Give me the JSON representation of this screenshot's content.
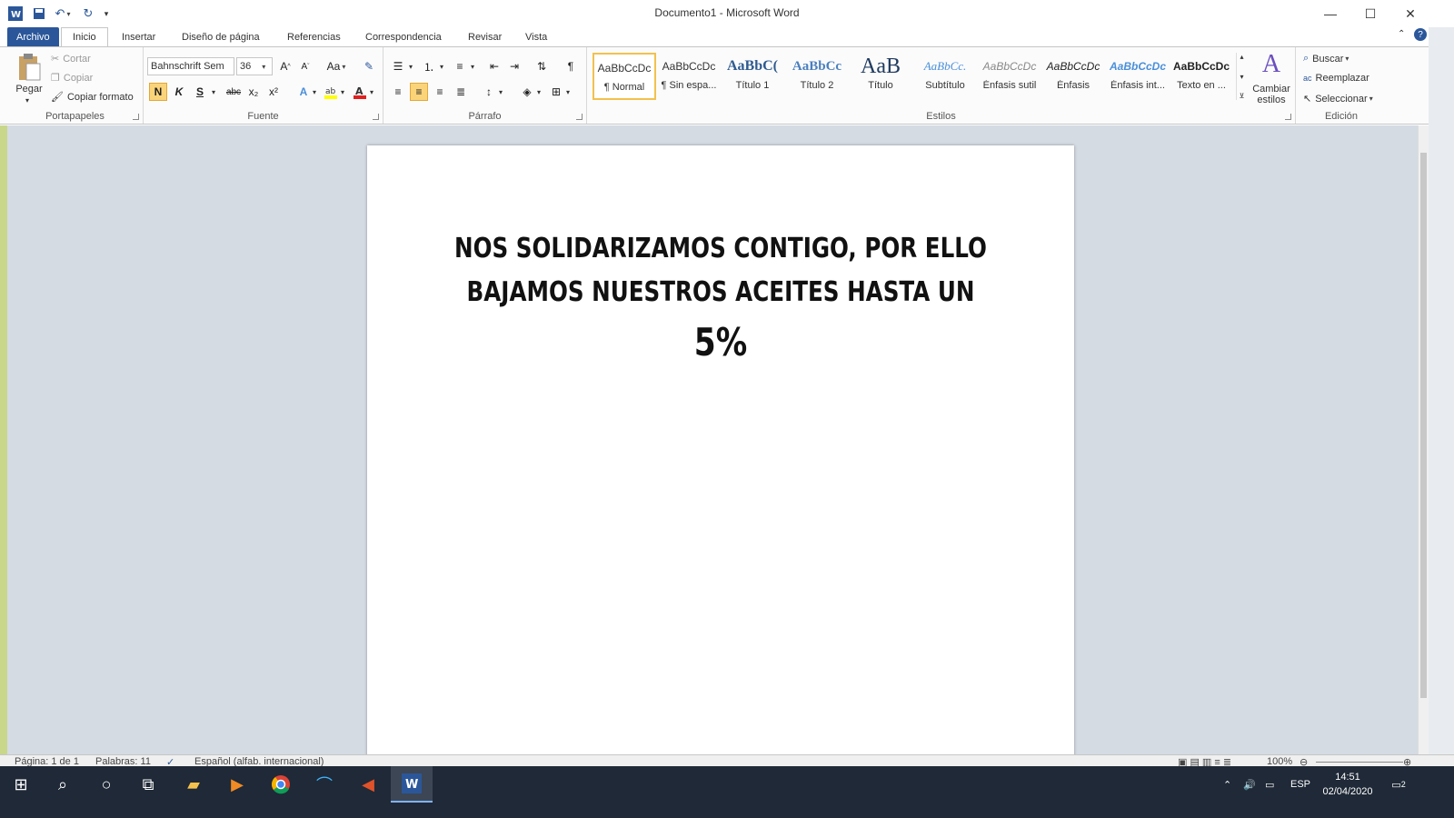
{
  "window": {
    "title": "Documento1  -  Microsoft Word",
    "minimize": "—",
    "maximize": "☐",
    "close": "✕"
  },
  "tabs": [
    "Archivo",
    "Inicio",
    "Insertar",
    "Diseño de página",
    "Referencias",
    "Correspondencia",
    "Revisar",
    "Vista"
  ],
  "ribbon": {
    "clipboard": {
      "label": "Portapapeles",
      "paste": "Pegar",
      "cut": "Cortar",
      "copy": "Copiar",
      "format_painter": "Copiar formato"
    },
    "font": {
      "label": "Fuente",
      "font_name": "Bahnschrift Sem",
      "font_size": "36",
      "bold": "N",
      "italic": "K",
      "underline": "S",
      "strike": "abc",
      "subscript": "x₂",
      "superscript": "x²",
      "case": "Aa"
    },
    "paragraph": {
      "label": "Párrafo",
      "pilcrow": "¶"
    },
    "styles": {
      "label": "Estilos",
      "items": [
        {
          "preview": "AaBbCcDc",
          "name": "¶ Normal"
        },
        {
          "preview": "AaBbCcDc",
          "name": "¶ Sin espa..."
        },
        {
          "preview": "AaBbC(",
          "name": "Título 1"
        },
        {
          "preview": "AaBbCc",
          "name": "Título 2"
        },
        {
          "preview": "AaB",
          "name": "Título"
        },
        {
          "preview": "AaBbCc.",
          "name": "Subtítulo"
        },
        {
          "preview": "AaBbCcDc",
          "name": "Énfasis sutil"
        },
        {
          "preview": "AaBbCcDc",
          "name": "Énfasis"
        },
        {
          "preview": "AaBbCcDc",
          "name": "Énfasis int..."
        },
        {
          "preview": "AaBbCcDc",
          "name": "Texto en ..."
        }
      ],
      "change_styles": "Cambiar estilos"
    },
    "editing": {
      "label": "Edición",
      "find": "Buscar",
      "replace": "Reemplazar",
      "select": "Seleccionar"
    }
  },
  "document": {
    "line1": "NOS SOLIDARIZAMOS CONTIGO, POR ELLO",
    "line2": "BAJAMOS NUESTROS ACEITES HASTA UN",
    "line3": "5%"
  },
  "statusbar": {
    "page": "Página: 1 de 1",
    "words": "Palabras: 11",
    "language": "Español (alfab. internacional)",
    "zoom": "100%"
  },
  "taskbar": {
    "language": "ESP",
    "time": "14:51",
    "date": "02/04/2020",
    "notifications": "2"
  },
  "colors": {
    "accent": "#2b579a",
    "doc_background": "#d4dbe3",
    "taskbar": "#1f2937",
    "selected_style_border": "#f2c14e"
  }
}
